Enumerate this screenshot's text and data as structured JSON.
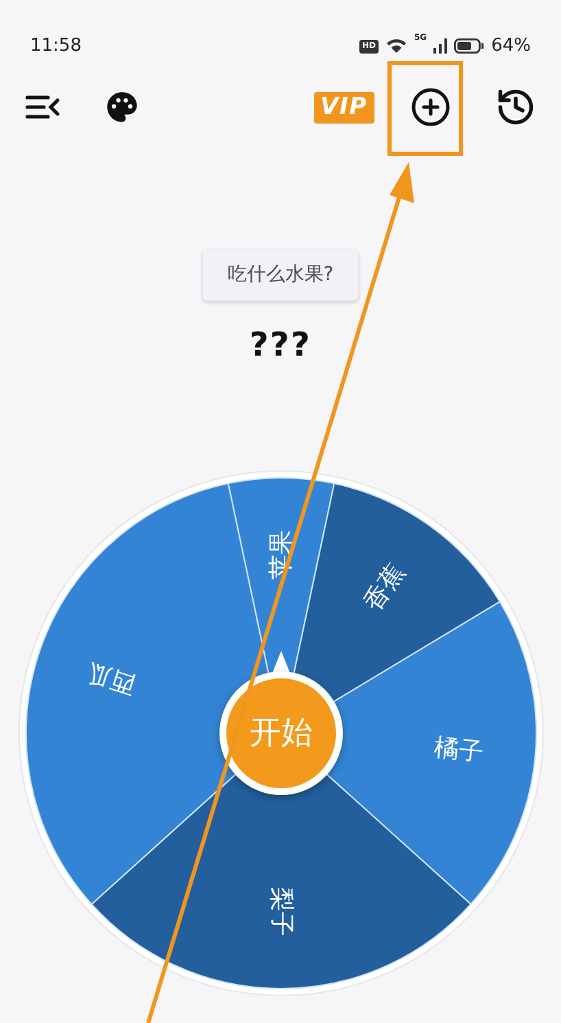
{
  "status_bar": {
    "time": "11:58",
    "hd": "HD",
    "network": "5G",
    "battery": "64%"
  },
  "toolbar": {
    "vip": "VIP"
  },
  "question": "吃什么水果?",
  "result": "???",
  "wheel": {
    "start": "开始",
    "segments": [
      {
        "label": "苹果",
        "color": "#3384d4"
      },
      {
        "label": "香蕉",
        "color": "#235f9d"
      },
      {
        "label": "橘子",
        "color": "#3384d4"
      },
      {
        "label": "梨子",
        "color": "#235f9d"
      },
      {
        "label": "西瓜",
        "color": "#3384d4"
      }
    ]
  }
}
